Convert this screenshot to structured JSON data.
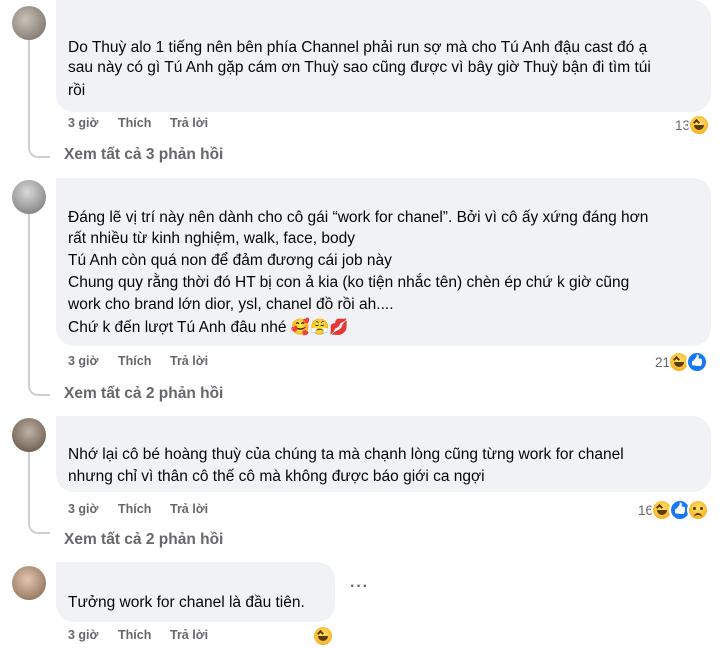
{
  "comments": [
    {
      "lines": [
        "Do Thuỳ alo 1 tiếng nên bên phía Channel phải run sợ mà cho Tú Anh đậu cast đó ạ",
        "sau này có gì Tú Anh gặp cám ơn Thuỳ sao cũng được vì bây giờ Thuỳ bận đi tìm túi",
        "rồi"
      ],
      "time": "3 giờ",
      "like": "Thích",
      "reply": "Trả lời",
      "reaction_count": "13",
      "reactions": [
        "haha-icon"
      ],
      "view_replies": "Xem tất cả 3 phản hồi"
    },
    {
      "lines": [
        "Đáng lẽ vị trí này nên dành cho cô gái “work for chanel”. Bởi vì cô ấy xứng đáng hơn",
        "rất nhiều từ kinh nghiệm, walk, face, body",
        "Tú Anh còn quá non để đảm đương cái job này",
        "Chung quy rằng thời đó HT bị con ả kia (ko tiện nhắc tên) chèn ép chứ k giờ cũng",
        "work cho brand lớn dior, ysl, chanel đồ rồi ah....",
        "Chứ k đến lượt Tú Anh đâu nhé 🥰😤💋"
      ],
      "time": "3 giờ",
      "like": "Thích",
      "reply": "Trả lời",
      "reaction_count": "21",
      "reactions": [
        "haha-icon",
        "like-icon"
      ],
      "view_replies": "Xem tất cả 2 phản hồi"
    },
    {
      "lines": [
        "Nhớ lại cô bé hoàng thuỳ của chúng ta mà chạnh lòng cũng từng work for chanel",
        "nhưng chỉ vì thân cô thế cô mà không được báo giới ca ngợi"
      ],
      "time": "3 giờ",
      "like": "Thích",
      "reply": "Trả lời",
      "reaction_count": "16",
      "reactions": [
        "haha-icon",
        "like-icon",
        "sad-icon"
      ],
      "view_replies": "Xem tất cả 2 phản hồi"
    },
    {
      "lines": [
        "Tưởng work for chanel là đầu tiên."
      ],
      "time": "3 giờ",
      "like": "Thích",
      "reply": "Trả lời",
      "reaction_count": "",
      "reactions": [
        "haha-icon"
      ],
      "more": "···"
    }
  ]
}
